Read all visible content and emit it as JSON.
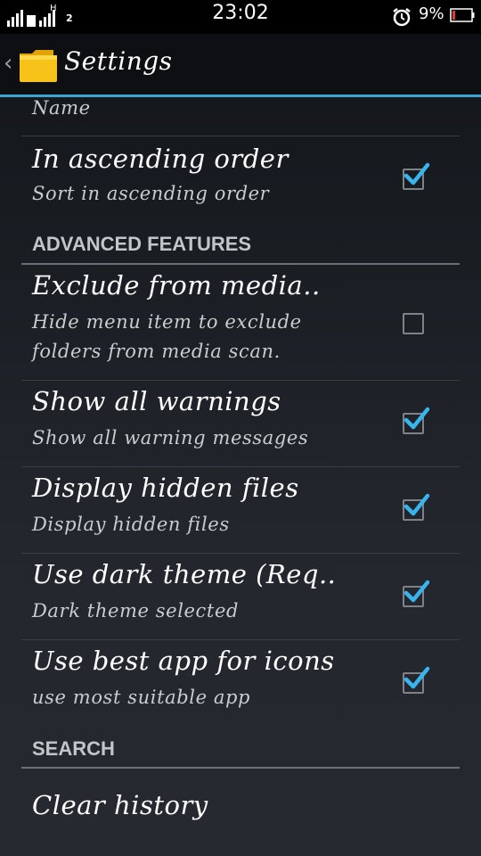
{
  "status_bar": {
    "time": "23:02",
    "battery_percent": "9%",
    "network_badge": "H",
    "sim_slot": "2",
    "icons": [
      "signal-icon",
      "alarm-icon",
      "battery-icon"
    ]
  },
  "action_bar": {
    "title": "Settings",
    "icons": [
      "back-chevron-icon",
      "folder-icon"
    ],
    "accent_color": "#38a4d6"
  },
  "list": {
    "partial_item_label": "Name",
    "items": [
      {
        "title": "In ascending order",
        "summary": "Sort in ascending order",
        "checked": true
      }
    ],
    "sections": [
      {
        "header": "ADVANCED FEATURES",
        "items": [
          {
            "title": "Exclude from media..",
            "summary_line1": "Hide menu item to exclude",
            "summary_line2": "folders from media scan.",
            "checked": false
          },
          {
            "title": "Show all warnings",
            "summary": "Show all warning messages",
            "checked": true
          },
          {
            "title": "Display hidden files",
            "summary": "Display hidden files",
            "checked": true
          },
          {
            "title": "Use dark theme (Req..",
            "summary": "Dark theme selected",
            "checked": true
          },
          {
            "title": "Use best app for icons",
            "summary": "use most suitable app",
            "checked": true
          }
        ]
      },
      {
        "header": "SEARCH",
        "items": [
          {
            "title": "Clear history"
          }
        ]
      }
    ]
  }
}
